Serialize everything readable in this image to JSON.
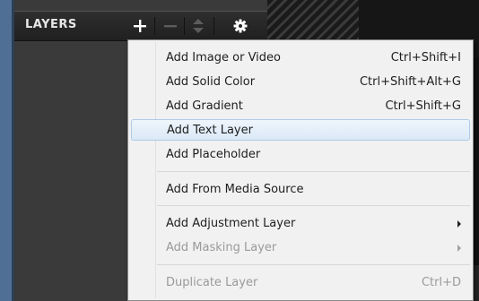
{
  "panel": {
    "title": "LAYERS",
    "toolbar": [
      {
        "name": "add-layer-button",
        "icon": "plus-icon"
      },
      {
        "name": "remove-layer-button",
        "icon": "minus-icon"
      },
      {
        "name": "reorder-layer-button",
        "icon": "up-down-arrows-icon"
      },
      {
        "name": "layer-settings-button",
        "icon": "gear-icon"
      }
    ]
  },
  "menu": {
    "items": [
      {
        "label": "Add Image or Video",
        "shortcut": "Ctrl+Shift+I"
      },
      {
        "label": "Add Solid Color",
        "shortcut": "Ctrl+Shift+Alt+G"
      },
      {
        "label": "Add Gradient",
        "shortcut": "Ctrl+Shift+G"
      },
      {
        "label": "Add Text Layer",
        "shortcut": "",
        "highlighted": true
      },
      {
        "label": "Add Placeholder",
        "shortcut": ""
      },
      {
        "label": "Add From Media Source",
        "shortcut": ""
      },
      {
        "label": "Add Adjustment Layer",
        "submenu": true
      },
      {
        "label": "Add Masking Layer",
        "submenu": true,
        "disabled": true
      },
      {
        "label": "Duplicate Layer",
        "shortcut": "Ctrl+D",
        "disabled": true
      }
    ]
  },
  "colors": {
    "highlight": "#dbe9f7",
    "highlight_border": "#aecbe9",
    "panel_bg": "#3a3a3a",
    "menu_bg": "#f1f1f1"
  }
}
